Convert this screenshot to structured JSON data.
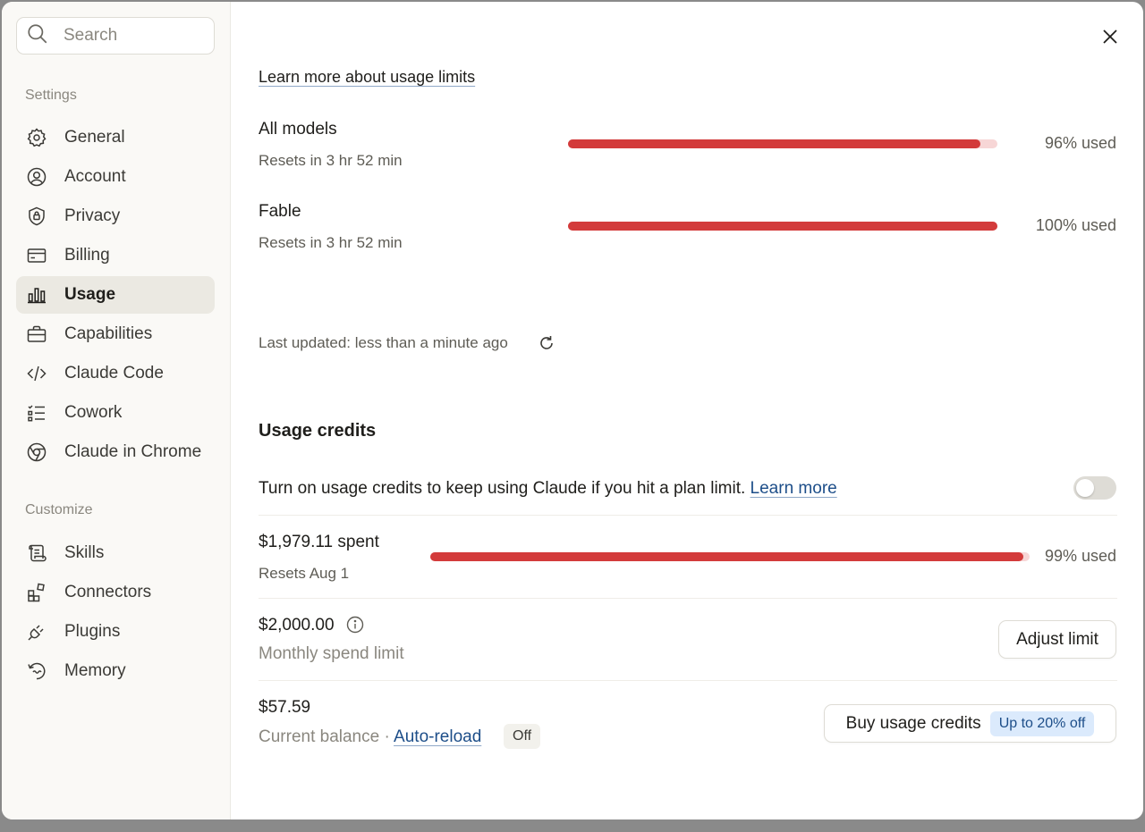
{
  "search": {
    "placeholder": "Search"
  },
  "sidebar": {
    "settings_label": "Settings",
    "customize_label": "Customize",
    "items": [
      {
        "label": "General",
        "icon": "gear-icon"
      },
      {
        "label": "Account",
        "icon": "user-circle-icon"
      },
      {
        "label": "Privacy",
        "icon": "shield-icon"
      },
      {
        "label": "Billing",
        "icon": "credit-card-icon"
      },
      {
        "label": "Usage",
        "icon": "bar-chart-icon",
        "active": true
      },
      {
        "label": "Capabilities",
        "icon": "briefcase-icon"
      },
      {
        "label": "Claude Code",
        "icon": "code-icon"
      },
      {
        "label": "Cowork",
        "icon": "checklist-icon"
      },
      {
        "label": "Claude in Chrome",
        "icon": "globe-icon"
      }
    ],
    "customize_items": [
      {
        "label": "Skills",
        "icon": "scroll-icon"
      },
      {
        "label": "Connectors",
        "icon": "blocks-icon"
      },
      {
        "label": "Plugins",
        "icon": "plug-icon"
      },
      {
        "label": "Memory",
        "icon": "memory-icon"
      }
    ]
  },
  "usage": {
    "learn_more_link": "Learn more about usage limits",
    "limits": [
      {
        "name": "All models",
        "resets": "Resets in 3 hr 52 min",
        "percent": 96,
        "percent_label": "96% used"
      },
      {
        "name": "Fable",
        "resets": "Resets in 3 hr 52 min",
        "percent": 100,
        "percent_label": "100% used"
      }
    ],
    "last_updated": "Last updated: less than a minute ago"
  },
  "credits": {
    "title": "Usage credits",
    "description": "Turn on usage credits to keep using Claude if you hit a plan limit.",
    "learn_more": "Learn more",
    "toggle_on": false,
    "spent": "$1,979.11 spent",
    "spent_resets": "Resets Aug 1",
    "spent_percent": 99,
    "spent_percent_label": "99% used",
    "limit_amount": "$2,000.00",
    "limit_label": "Monthly spend limit",
    "adjust_button": "Adjust limit",
    "balance_amount": "$57.59",
    "balance_label": "Current balance",
    "balance_sep": "·",
    "auto_reload_link": "Auto-reload",
    "auto_reload_status": "Off",
    "buy_button": "Buy usage credits",
    "buy_badge": "Up to 20% off"
  },
  "colors": {
    "accent_red": "#d33b3b",
    "link_blue": "#1d4e89",
    "badge_bg": "#dbeafc"
  }
}
